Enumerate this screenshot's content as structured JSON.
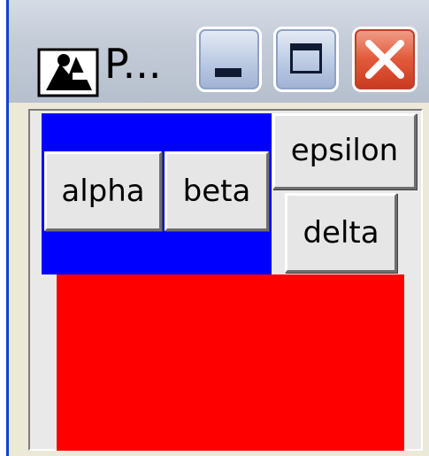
{
  "window": {
    "title": "P...",
    "icon": "app-icon",
    "controls": {
      "minimize_icon": "minimize-icon",
      "maximize_icon": "maximize-icon",
      "close_icon": "close-icon"
    }
  },
  "buttons": {
    "alpha": "alpha",
    "beta": "beta",
    "epsilon": "epsilon",
    "delta": "delta"
  },
  "colors": {
    "blue_panel": "#0000ff",
    "red_panel": "#ff0000",
    "close_button": "#e2593a"
  }
}
